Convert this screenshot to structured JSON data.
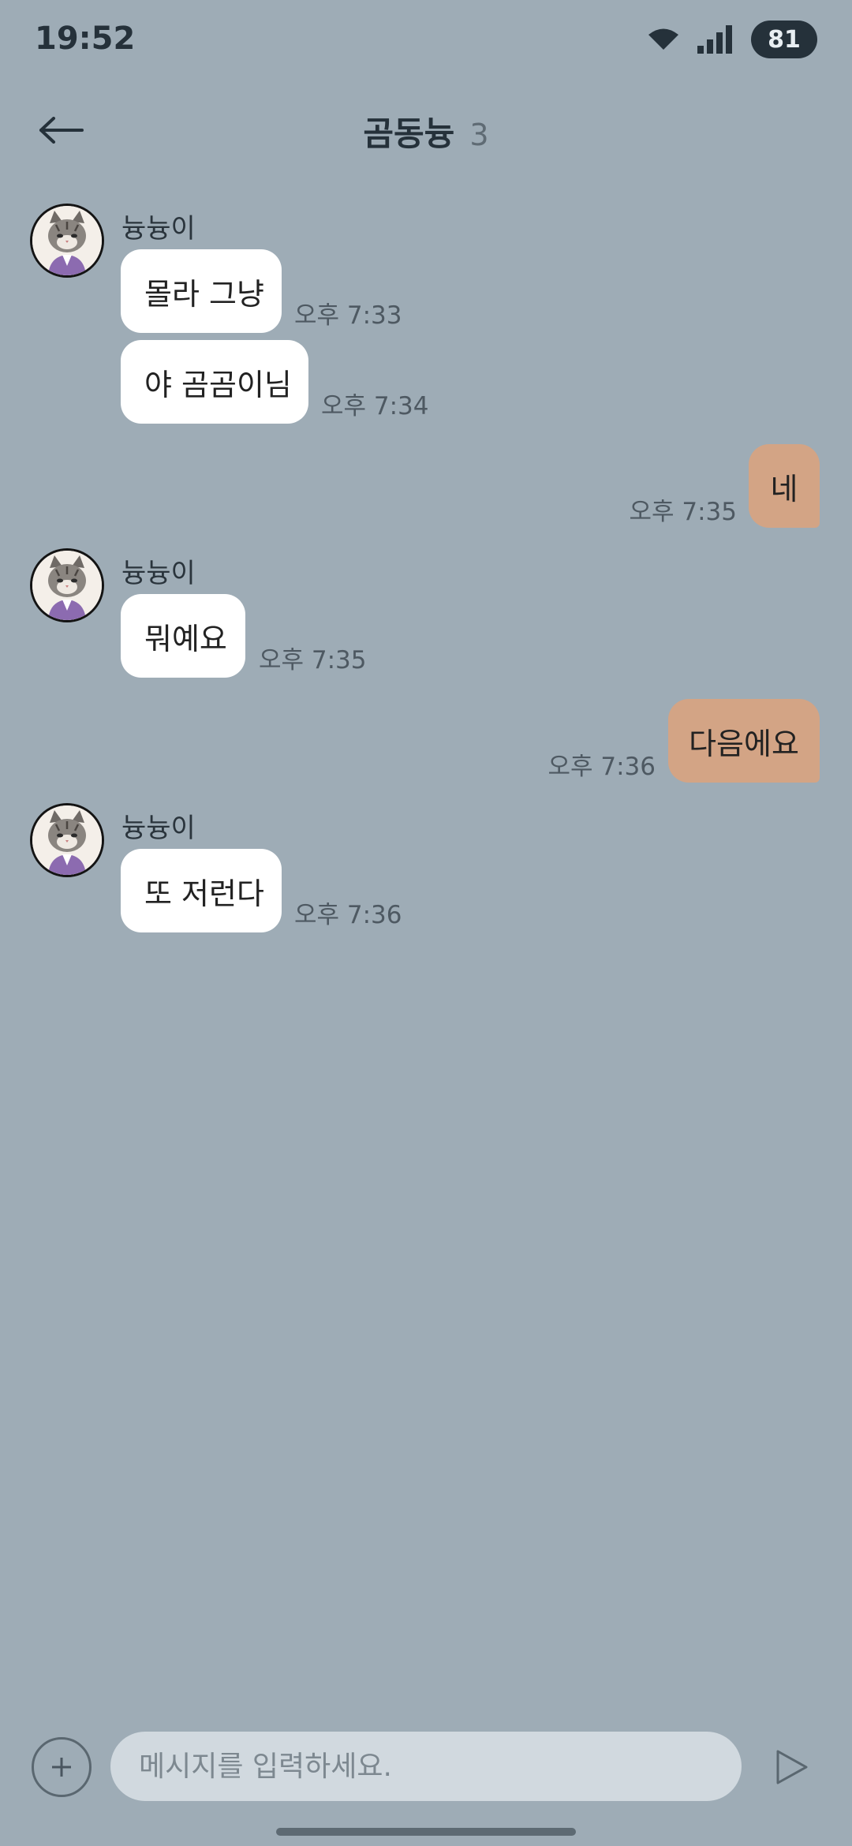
{
  "status_bar": {
    "time": "19:52",
    "battery": "81"
  },
  "header": {
    "title": "곰동늉",
    "member_count": "3"
  },
  "messages": [
    {
      "sender": "늉늉이",
      "text": "몰라 그냥",
      "time": "오후 7:33",
      "mine": false
    },
    {
      "sender": "늉늉이",
      "text": "야 곰곰이님",
      "time": "오후 7:34",
      "mine": false
    },
    {
      "sender": "me",
      "text": "네",
      "time": "오후 7:35",
      "mine": true
    },
    {
      "sender": "늉늉이",
      "text": "뭐예요",
      "time": "오후 7:35",
      "mine": false
    },
    {
      "sender": "me",
      "text": "다음에요",
      "time": "오후 7:36",
      "mine": true
    },
    {
      "sender": "늉늉이",
      "text": "또 저런다",
      "time": "오후 7:36",
      "mine": false
    }
  ],
  "sender_names": [
    "늉늉이",
    "늉늉이",
    "늉늉이"
  ],
  "input": {
    "placeholder": "메시지를 입력하세요."
  },
  "colors": {
    "background": "#9eacb6",
    "incoming_bubble": "#ffffff",
    "outgoing_bubble": "#d3a485",
    "input_field": "#d1d9df",
    "dark_text": "#25313a"
  },
  "icons": {
    "back": "arrow-left-icon",
    "wifi": "wifi-icon",
    "signal": "signal-icon",
    "attach": "plus-icon",
    "send": "send-triangle-icon",
    "avatar": "cat-avatar-icon"
  }
}
